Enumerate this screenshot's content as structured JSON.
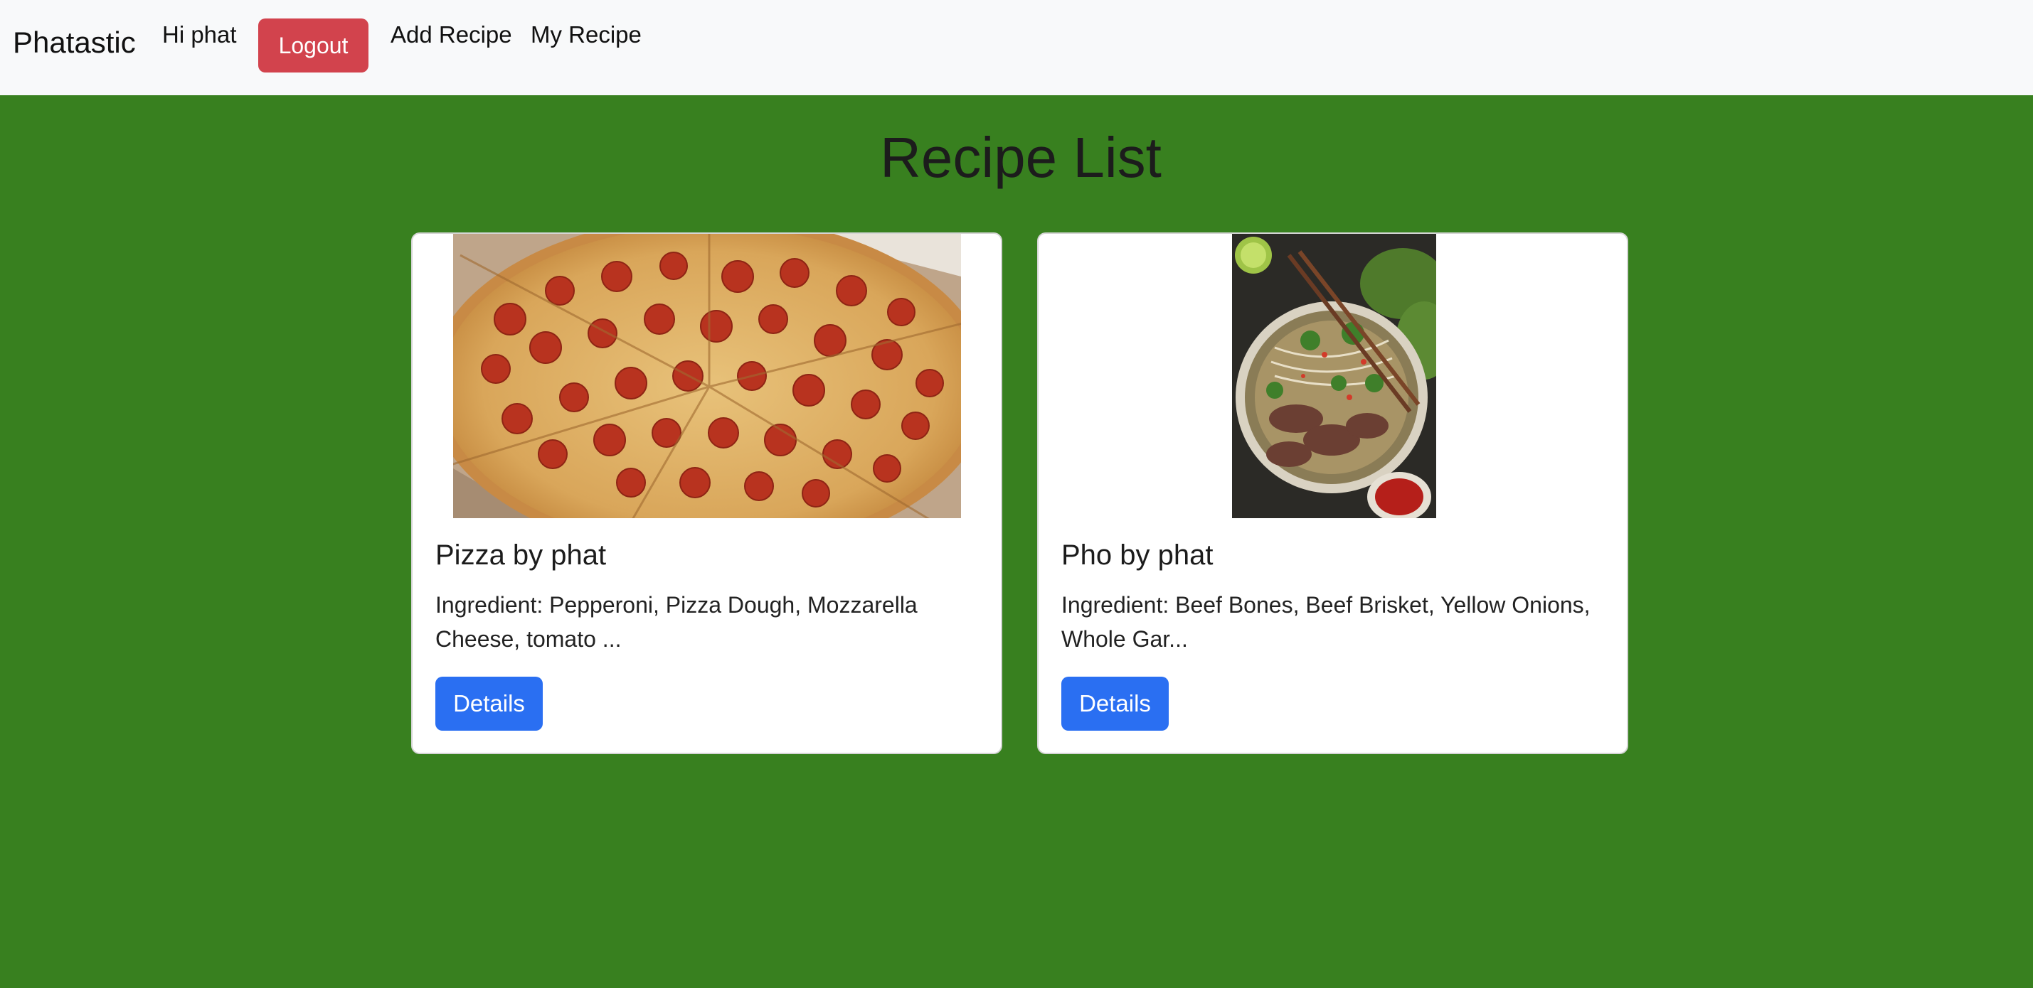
{
  "navbar": {
    "brand": "Phatastic",
    "greeting": "Hi phat",
    "logout_label": "Logout",
    "links": [
      "Add Recipe",
      "My Recipe"
    ]
  },
  "page": {
    "title": "Recipe List"
  },
  "recipes": [
    {
      "title": "Pizza by phat",
      "ingredients": "Ingredient: Pepperoni, Pizza Dough, Mozzarella Cheese, tomato ...",
      "button_label": "Details"
    },
    {
      "title": "Pho by phat",
      "ingredients": "Ingredient: Beef Bones, Beef Brisket, Yellow Onions, Whole Gar...",
      "button_label": "Details"
    }
  ],
  "colors": {
    "page_background": "#38801f",
    "navbar_background": "#f8f9fa",
    "logout_button": "#d2434d",
    "details_button": "#2a6ff2"
  }
}
